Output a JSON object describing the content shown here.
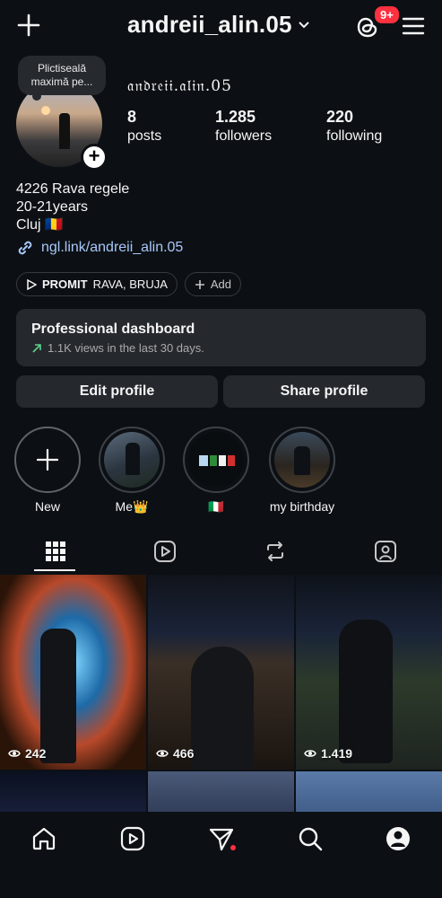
{
  "header": {
    "username": "andreii_alin.05",
    "notification_badge": "9+"
  },
  "profile": {
    "note": "Plictiseală maximă pe...",
    "display_name": "𝔞𝔫𝔡𝔯𝔢𝔦𝔦.𝔞𝔩𝔦𝔫.05",
    "stats": [
      {
        "value": "8",
        "label": "posts"
      },
      {
        "value": "1.285",
        "label": "followers"
      },
      {
        "value": "220",
        "label": "following"
      }
    ],
    "bio": [
      "4226 Rava regele",
      "20-21years",
      "Cluj 🇷🇴"
    ],
    "link": "ngl.link/andreii_alin.05",
    "music_chip": {
      "bold": "PROMIT",
      "rest": "RAVA, BRUJA"
    },
    "add_chip": "Add"
  },
  "dashboard": {
    "title": "Professional dashboard",
    "subtitle": "1.1K views in the last 30 days."
  },
  "actions": {
    "edit": "Edit profile",
    "share": "Share profile"
  },
  "highlights": [
    {
      "label": "New"
    },
    {
      "label": "Me👑"
    },
    {
      "label": "🇮🇹"
    },
    {
      "label": "my birthday"
    }
  ],
  "posts": [
    {
      "views": "242"
    },
    {
      "views": "466"
    },
    {
      "views": "1.419"
    }
  ],
  "colors": {
    "background": "#0c1014",
    "surface": "#25292e",
    "link": "#a8c7fa",
    "badge": "#ff3040"
  }
}
